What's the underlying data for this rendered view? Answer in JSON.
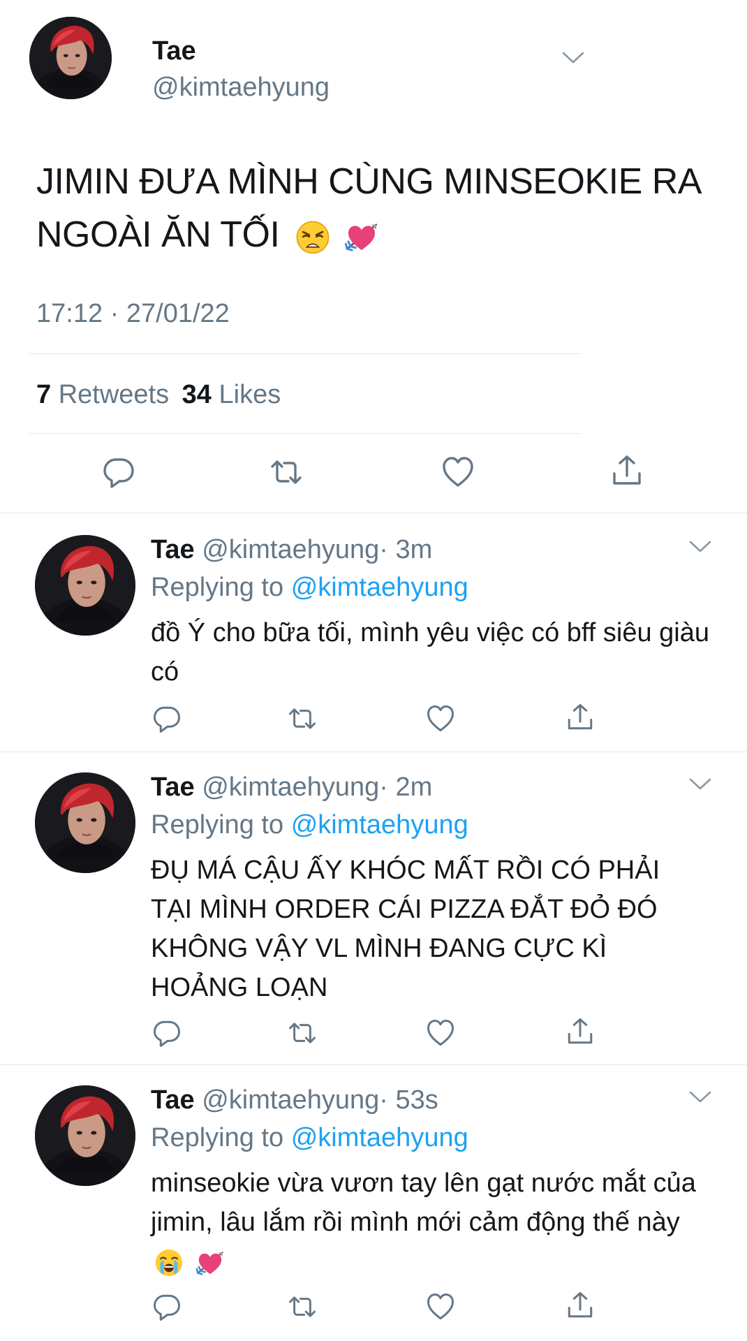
{
  "main_tweet": {
    "name": "Tae",
    "handle": "@kimtaehyung",
    "text": "JIMIN ĐƯA MÌNH CÙNG MINSEOKIE RA NGOÀI ĂN TỐI",
    "emojis": [
      "weary-face",
      "heart-with-arrow"
    ],
    "timestamp": "17:12 · 27/01/22",
    "retweets_count": "7",
    "retweets_label": "Retweets",
    "likes_count": "34",
    "likes_label": "Likes"
  },
  "replies": [
    {
      "name": "Tae",
      "handle": "@kimtaehyung",
      "age": "· 3m",
      "replying_label": "Replying to",
      "replying_to": "@kimtaehyung",
      "text": "đồ Ý cho bữa tối, mình yêu việc có bff siêu giàu có"
    },
    {
      "name": "Tae",
      "handle": "@kimtaehyung",
      "age": "· 2m",
      "replying_label": "Replying to",
      "replying_to": "@kimtaehyung",
      "text": "ĐỤ MÁ CẬU ẤY KHÓC MẤT RỒI CÓ PHẢI TẠI MÌNH ORDER CÁI PIZZA ĐẮT ĐỎ ĐÓ KHÔNG VẬY VL MÌNH ĐANG CỰC KÌ HOẢNG LOẠN"
    },
    {
      "name": "Tae",
      "handle": "@kimtaehyung",
      "age": "· 53s",
      "replying_label": "Replying to",
      "replying_to": "@kimtaehyung",
      "text": "minseokie vừa vươn tay lên gạt nước mắt của jimin, lâu lắm rồi mình mới cảm động thế này",
      "emojis": [
        "loudly-crying-face",
        "heart-with-arrow"
      ]
    }
  ],
  "icons": {
    "reply": "speech-bubble-icon",
    "retweet": "retweet-arrows-icon",
    "like": "heart-outline-icon",
    "share": "share-upload-icon",
    "more": "chevron-down-icon"
  },
  "colors": {
    "text": "#14171a",
    "secondary": "#657786",
    "link": "#1da1f2",
    "divider": "#e1e8ed",
    "heart_emoji": "#e8407a"
  }
}
